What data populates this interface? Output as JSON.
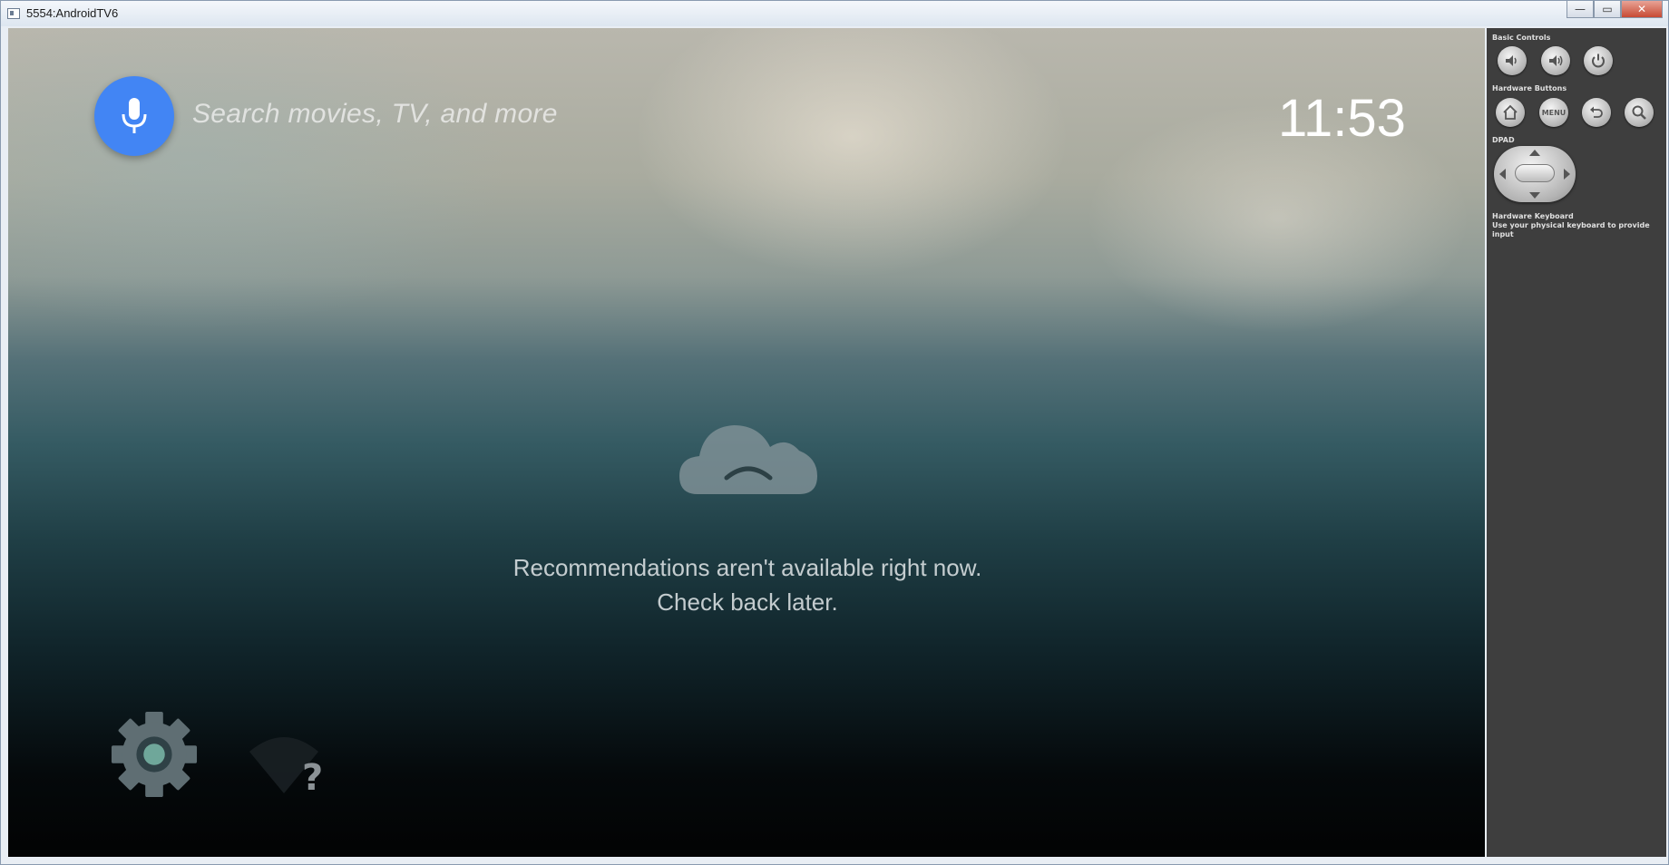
{
  "window": {
    "title": "5554:AndroidTV6",
    "minimize_label": "—",
    "maximize_label": "▭",
    "close_label": "✕"
  },
  "tv": {
    "search_placeholder": "Search movies, TV, and more",
    "clock": "11:53",
    "message_line1": "Recommendations aren't available right now.",
    "message_line2": "Check back later.",
    "wifi_unknown_glyph": "?",
    "accent_color": "#4285f4"
  },
  "controls": {
    "basic_controls_label": "Basic Controls",
    "hardware_buttons_label": "Hardware Buttons",
    "menu_label": "MENU",
    "dpad_label": "DPAD",
    "keyboard_label": "Hardware Keyboard",
    "keyboard_hint": "Use your physical keyboard to provide input"
  }
}
